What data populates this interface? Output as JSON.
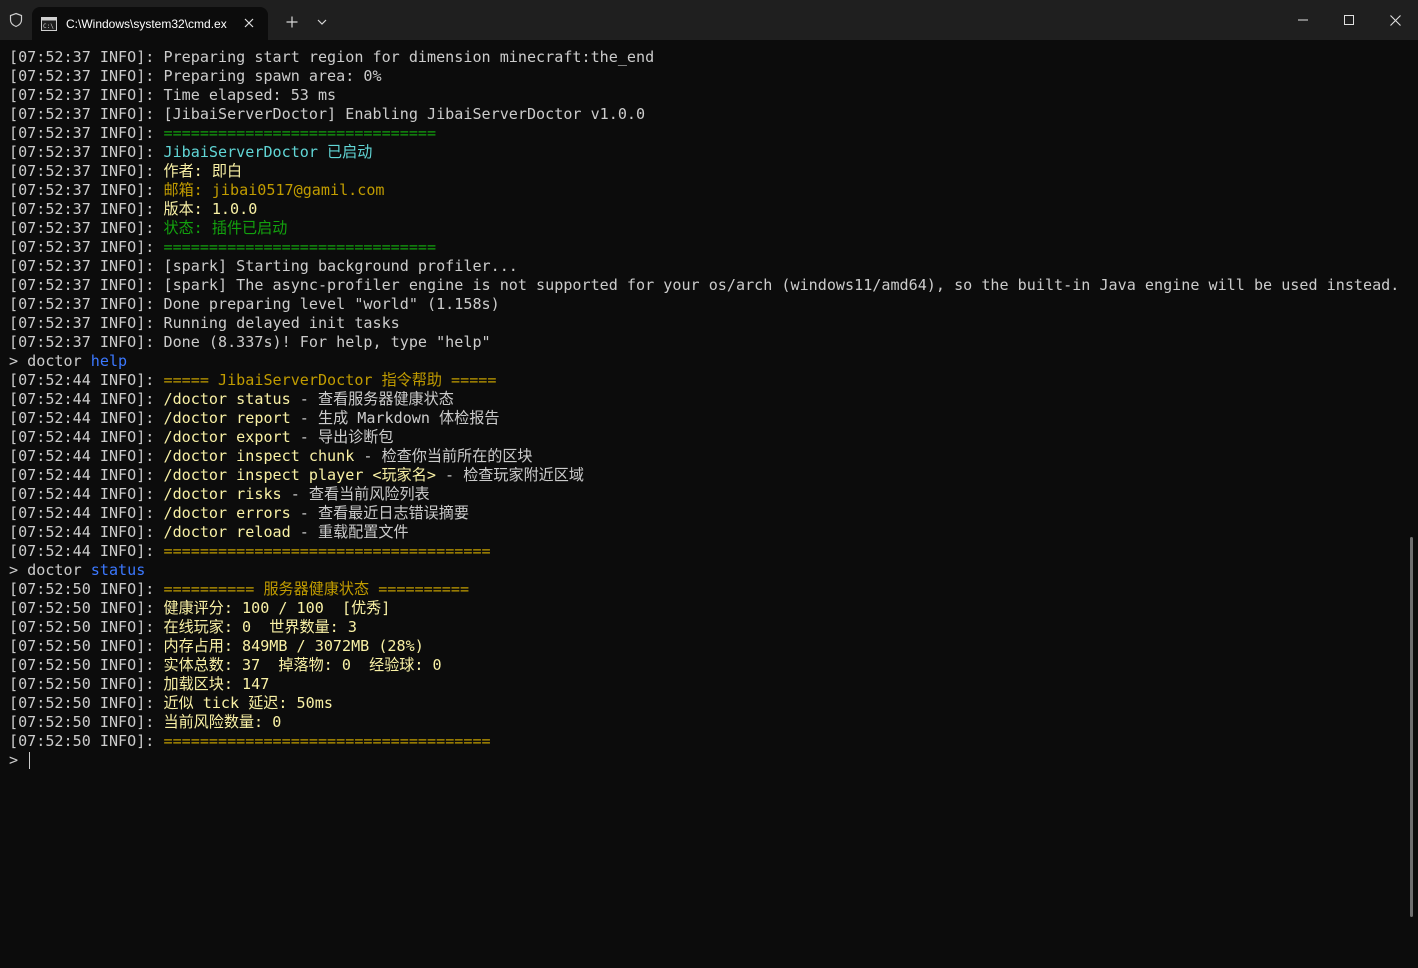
{
  "window": {
    "tab_title": "C:\\Windows\\system32\\cmd.ex",
    "icons": {
      "shield": "shield-icon",
      "tab": "cmd-icon",
      "tab_close": "close-icon",
      "new_tab": "plus-icon",
      "dropdown": "chevron-down-icon",
      "minimize": "minimize-icon",
      "maximize": "maximize-icon",
      "close": "close-icon"
    }
  },
  "colors": {
    "background": "#0c0c0c",
    "titlebar": "#1f1f1f",
    "default_text": "#cccccc",
    "cyan": "#61d6d6",
    "gold": "#c19c00",
    "green": "#13a10e",
    "yellow": "#f9f1a5",
    "blue": "#3b78ff"
  },
  "console": {
    "prompt": "> ",
    "lines": [
      [
        {
          "t": "[07:52:37 INFO]: Preparing start region for dimension minecraft:the_end",
          "c": "default"
        }
      ],
      [
        {
          "t": "[07:52:37 INFO]: Preparing spawn area: 0%",
          "c": "default"
        }
      ],
      [
        {
          "t": "[07:52:37 INFO]: Time elapsed: 53 ms",
          "c": "default"
        }
      ],
      [
        {
          "t": "[07:52:37 INFO]: [JibaiServerDoctor] Enabling JibaiServerDoctor v1.0.0",
          "c": "default"
        }
      ],
      [
        {
          "t": "[07:52:37 INFO]: ",
          "c": "default"
        },
        {
          "t": "==============================",
          "c": "green"
        }
      ],
      [
        {
          "t": "[07:52:37 INFO]: ",
          "c": "default"
        },
        {
          "t": "JibaiServerDoctor 已启动",
          "c": "cyan"
        }
      ],
      [
        {
          "t": "[07:52:37 INFO]: ",
          "c": "default"
        },
        {
          "t": "作者: 即白",
          "c": "yellow"
        }
      ],
      [
        {
          "t": "[07:52:37 INFO]: ",
          "c": "default"
        },
        {
          "t": "邮箱: jibai0517@gamil.com",
          "c": "gold"
        }
      ],
      [
        {
          "t": "[07:52:37 INFO]: ",
          "c": "default"
        },
        {
          "t": "版本: 1.0.0",
          "c": "yellow"
        }
      ],
      [
        {
          "t": "[07:52:37 INFO]: ",
          "c": "default"
        },
        {
          "t": "状态: 插件已启动",
          "c": "green"
        }
      ],
      [
        {
          "t": "[07:52:37 INFO]: ",
          "c": "default"
        },
        {
          "t": "==============================",
          "c": "green"
        }
      ],
      [
        {
          "t": "[07:52:37 INFO]: [spark] Starting background profiler...",
          "c": "default"
        }
      ],
      [
        {
          "t": "[07:52:37 INFO]: [spark] The async-profiler engine is not supported for your os/arch (windows11/amd64), so the built-in Java engine will be used instead.",
          "c": "default"
        }
      ],
      [
        {
          "t": "[07:52:37 INFO]: Done preparing level \"world\" (1.158s)",
          "c": "default"
        }
      ],
      [
        {
          "t": "[07:52:37 INFO]: Running delayed init tasks",
          "c": "default"
        }
      ],
      [
        {
          "t": "[07:52:37 INFO]: Done (8.337s)! For help, type \"help\"",
          "c": "default"
        }
      ],
      [
        {
          "t": "> doctor ",
          "c": "default"
        },
        {
          "t": "help",
          "c": "blue"
        }
      ],
      [
        {
          "t": "[07:52:44 INFO]: ",
          "c": "default"
        },
        {
          "t": "===== JibaiServerDoctor 指令帮助 =====",
          "c": "gold"
        }
      ],
      [
        {
          "t": "[07:52:44 INFO]: ",
          "c": "default"
        },
        {
          "t": "/doctor status",
          "c": "yellow"
        },
        {
          "t": " - 查看服务器健康状态",
          "c": "default"
        }
      ],
      [
        {
          "t": "[07:52:44 INFO]: ",
          "c": "default"
        },
        {
          "t": "/doctor report",
          "c": "yellow"
        },
        {
          "t": " - 生成 Markdown 体检报告",
          "c": "default"
        }
      ],
      [
        {
          "t": "[07:52:44 INFO]: ",
          "c": "default"
        },
        {
          "t": "/doctor export",
          "c": "yellow"
        },
        {
          "t": " - 导出诊断包",
          "c": "default"
        }
      ],
      [
        {
          "t": "[07:52:44 INFO]: ",
          "c": "default"
        },
        {
          "t": "/doctor inspect chunk",
          "c": "yellow"
        },
        {
          "t": " - 检查你当前所在的区块",
          "c": "default"
        }
      ],
      [
        {
          "t": "[07:52:44 INFO]: ",
          "c": "default"
        },
        {
          "t": "/doctor inspect player <玩家名>",
          "c": "yellow"
        },
        {
          "t": " - 检查玩家附近区域",
          "c": "default"
        }
      ],
      [
        {
          "t": "[07:52:44 INFO]: ",
          "c": "default"
        },
        {
          "t": "/doctor risks",
          "c": "yellow"
        },
        {
          "t": " - 查看当前风险列表",
          "c": "default"
        }
      ],
      [
        {
          "t": "[07:52:44 INFO]: ",
          "c": "default"
        },
        {
          "t": "/doctor errors",
          "c": "yellow"
        },
        {
          "t": " - 查看最近日志错误摘要",
          "c": "default"
        }
      ],
      [
        {
          "t": "[07:52:44 INFO]: ",
          "c": "default"
        },
        {
          "t": "/doctor reload",
          "c": "yellow"
        },
        {
          "t": " - 重载配置文件",
          "c": "default"
        }
      ],
      [
        {
          "t": "[07:52:44 INFO]: ",
          "c": "default"
        },
        {
          "t": "====================================",
          "c": "gold"
        }
      ],
      [
        {
          "t": "> doctor ",
          "c": "default"
        },
        {
          "t": "status",
          "c": "blue"
        }
      ],
      [
        {
          "t": "[07:52:50 INFO]: ",
          "c": "default"
        },
        {
          "t": "========== 服务器健康状态 ==========",
          "c": "gold"
        }
      ],
      [
        {
          "t": "[07:52:50 INFO]: ",
          "c": "default"
        },
        {
          "t": "健康评分: 100 / 100  [优秀]",
          "c": "yellow"
        }
      ],
      [
        {
          "t": "[07:52:50 INFO]: ",
          "c": "default"
        },
        {
          "t": "在线玩家: 0  世界数量: 3",
          "c": "yellow"
        }
      ],
      [
        {
          "t": "[07:52:50 INFO]: ",
          "c": "default"
        },
        {
          "t": "内存占用: 849MB / 3072MB (28%)",
          "c": "yellow"
        }
      ],
      [
        {
          "t": "[07:52:50 INFO]: ",
          "c": "default"
        },
        {
          "t": "实体总数: 37  掉落物: 0  经验球: 0",
          "c": "yellow"
        }
      ],
      [
        {
          "t": "[07:52:50 INFO]: ",
          "c": "default"
        },
        {
          "t": "加载区块: 147",
          "c": "yellow"
        }
      ],
      [
        {
          "t": "[07:52:50 INFO]: ",
          "c": "default"
        },
        {
          "t": "近似 tick 延迟: 50ms",
          "c": "yellow"
        }
      ],
      [
        {
          "t": "[07:52:50 INFO]: ",
          "c": "default"
        },
        {
          "t": "当前风险数量: 0",
          "c": "yellow"
        }
      ],
      [
        {
          "t": "[07:52:50 INFO]: ",
          "c": "default"
        },
        {
          "t": "====================================",
          "c": "gold"
        }
      ]
    ]
  }
}
